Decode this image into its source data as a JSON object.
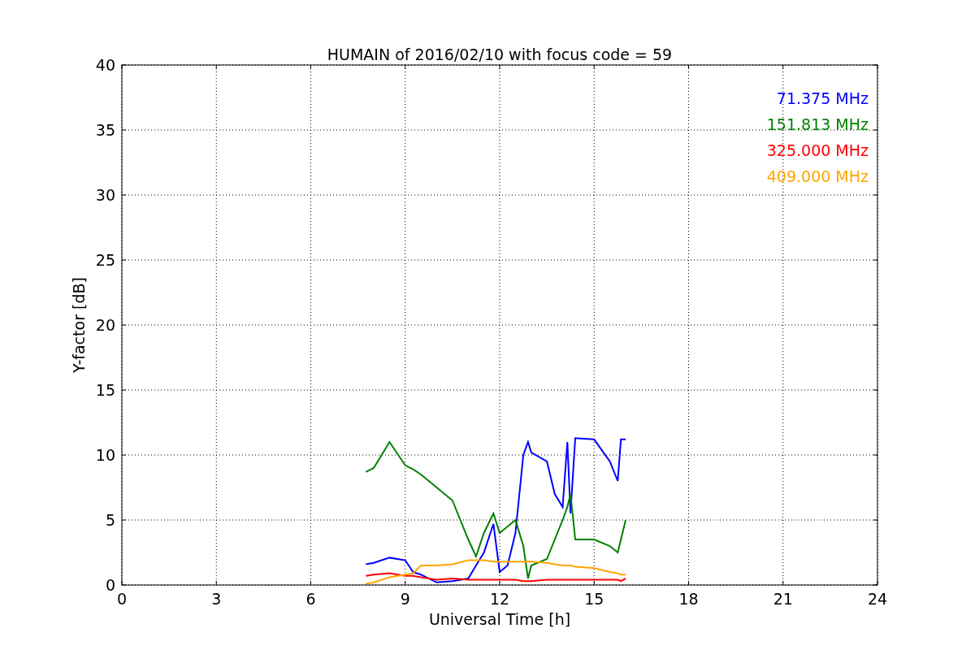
{
  "chart_data": {
    "type": "line",
    "grid": true,
    "title": "HUMAIN of 2016/02/10 with focus code = 59",
    "xlabel": "Universal Time [h]",
    "ylabel": "Y-factor [dB]",
    "xlim": [
      0,
      24
    ],
    "ylim": [
      0,
      40
    ],
    "xticks": [
      0,
      3,
      6,
      9,
      12,
      15,
      18,
      21,
      24
    ],
    "yticks": [
      0,
      5,
      10,
      15,
      20,
      25,
      30,
      35,
      40
    ],
    "x": [
      7.75,
      8,
      8.5,
      9,
      9.25,
      9.5,
      10,
      10.5,
      11,
      11.25,
      11.5,
      11.8,
      12,
      12.25,
      12.5,
      12.75,
      12.9,
      13,
      13.5,
      13.75,
      14,
      14.15,
      14.25,
      14.4,
      15,
      15.5,
      15.75,
      15.85,
      16
    ],
    "series": [
      {
        "name": "71.375 MHz",
        "color": "#0000ff",
        "values": [
          1.6,
          1.7,
          2.1,
          1.9,
          1.0,
          0.8,
          0.2,
          0.3,
          0.5,
          1.5,
          2.5,
          4.7,
          1.0,
          1.5,
          4.0,
          10.0,
          11.0,
          10.2,
          9.5,
          7.0,
          6.0,
          11.0,
          5.5,
          11.3,
          11.2,
          9.5,
          8.0,
          11.2,
          11.2
        ]
      },
      {
        "name": "151.813 MHz",
        "color": "#008000",
        "values": [
          8.7,
          9.0,
          11.0,
          9.2,
          8.9,
          8.5,
          7.5,
          6.5,
          3.5,
          2.2,
          4.0,
          5.5,
          4.0,
          4.5,
          5.0,
          3.0,
          0.5,
          1.5,
          2.0,
          3.5,
          5.0,
          6.0,
          7.0,
          3.5,
          3.5,
          3.0,
          2.5,
          3.5,
          5.0
        ]
      },
      {
        "name": "325.000 MHz",
        "color": "#ff0000",
        "values": [
          0.7,
          0.8,
          0.9,
          0.7,
          0.7,
          0.6,
          0.4,
          0.5,
          0.4,
          0.4,
          0.4,
          0.4,
          0.4,
          0.4,
          0.4,
          0.3,
          0.3,
          0.3,
          0.4,
          0.4,
          0.4,
          0.4,
          0.4,
          0.4,
          0.4,
          0.4,
          0.4,
          0.3,
          0.5
        ]
      },
      {
        "name": "409.000 MHz",
        "color": "#ffa500",
        "values": [
          0.1,
          0.2,
          0.6,
          0.8,
          0.9,
          1.5,
          1.5,
          1.6,
          1.9,
          1.9,
          1.9,
          1.8,
          1.8,
          1.8,
          1.8,
          1.8,
          1.8,
          1.8,
          1.7,
          1.6,
          1.5,
          1.5,
          1.5,
          1.4,
          1.3,
          1.0,
          0.9,
          0.8,
          0.8
        ]
      }
    ]
  }
}
